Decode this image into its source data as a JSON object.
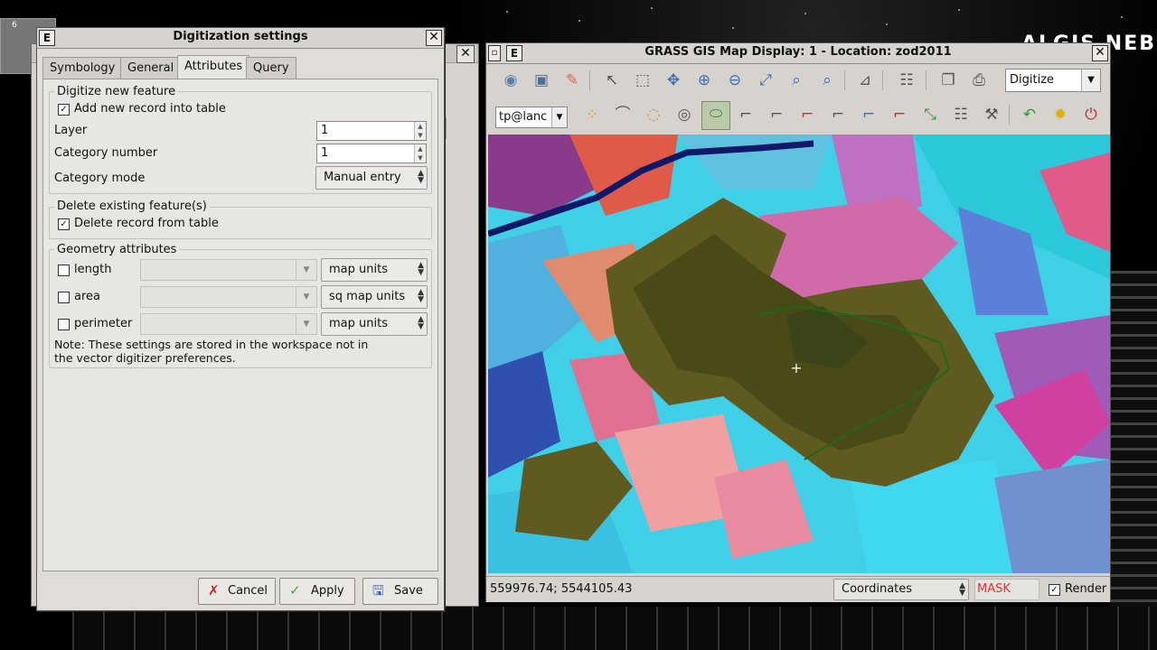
{
  "desktop": {
    "brand_text": "ALGIS NEB",
    "icon_label": "6"
  },
  "dialog": {
    "title": "Digitization settings",
    "title_letter": "E",
    "tabs": [
      {
        "label": "Symbology",
        "active": false
      },
      {
        "label": "General",
        "active": false
      },
      {
        "label": "Attributes",
        "active": true
      },
      {
        "label": "Query tool",
        "active": false
      }
    ],
    "new_feature": {
      "group_label": "Digitize new feature",
      "add_record_label": "Add new record into table",
      "add_record_checked": true,
      "layer_label": "Layer",
      "layer_value": "1",
      "category_number_label": "Category number",
      "category_number_value": "1",
      "category_mode_label": "Category mode",
      "category_mode_value": "Manual entry"
    },
    "delete_feature": {
      "group_label": "Delete existing feature(s)",
      "delete_record_label": "Delete record from table",
      "delete_record_checked": true
    },
    "geometry": {
      "group_label": "Geometry attributes",
      "rows": [
        {
          "label": "length",
          "checked": false,
          "column": "",
          "units": "map units"
        },
        {
          "label": "area",
          "checked": false,
          "column": "",
          "units": "sq map units"
        },
        {
          "label": "perimeter",
          "checked": false,
          "column": "",
          "units": "map units"
        }
      ],
      "note_line1": "Note: These settings are stored in the workspace not in",
      "note_line2": "the vector digitizer preferences."
    },
    "buttons": {
      "cancel": "Cancel",
      "apply": "Apply",
      "save": "Save"
    }
  },
  "map_display": {
    "title": "GRASS GIS Map Display: 1  - Location: zod2011",
    "title_letter": "E",
    "toolbar_mode": "Digitize",
    "vector_map": "tp@lanc",
    "status": {
      "coordinates": "559976.74; 5544105.43",
      "mode": "Coordinates",
      "mask": "MASK",
      "render_label": "Render",
      "render_checked": true
    },
    "colors": {
      "mask_red": "#e03030",
      "accent_green": "#2e9a2e"
    }
  }
}
